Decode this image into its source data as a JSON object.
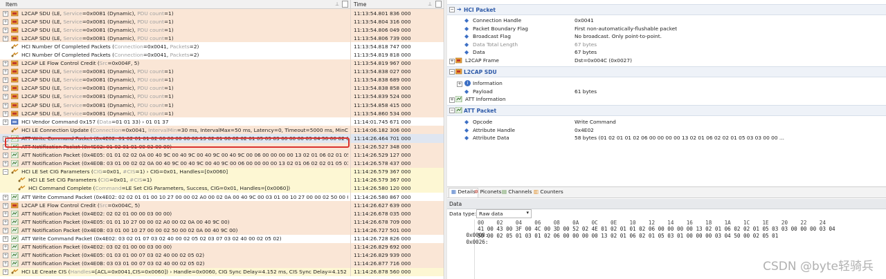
{
  "packet_list": {
    "col_item": "Item",
    "col_time": "Time",
    "rows": [
      {
        "bg": "salmon",
        "indent": 0,
        "exp": "+",
        "icon": "l2cap",
        "text": "L2CAP SDU (LE, ",
        "p1": "Service",
        "t1": "=0x0081 (Dynamic), ",
        "p2": "PDU count",
        "t2": "=1)",
        "time": "11:13:54.801 836 000"
      },
      {
        "bg": "salmon",
        "indent": 0,
        "exp": "+",
        "icon": "l2cap",
        "text": "L2CAP SDU (LE, ",
        "p1": "Service",
        "t1": "=0x0081 (Dynamic), ",
        "p2": "PDU count",
        "t2": "=1)",
        "time": "11:13:54.804 316 000"
      },
      {
        "bg": "salmon",
        "indent": 0,
        "exp": "+",
        "icon": "l2cap",
        "text": "L2CAP SDU (LE, ",
        "p1": "Service",
        "t1": "=0x0081 (Dynamic), ",
        "p2": "PDU count",
        "t2": "=1)",
        "time": "11:13:54.806 049 000"
      },
      {
        "bg": "salmon",
        "indent": 0,
        "exp": "+",
        "icon": "l2cap",
        "text": "L2CAP SDU (LE, ",
        "p1": "Service",
        "t1": "=0x0081 (Dynamic), ",
        "p2": "PDU count",
        "t2": "=1)",
        "time": "11:13:54.806 739 000"
      },
      {
        "bg": "white",
        "indent": 0,
        "exp": "",
        "icon": "hci",
        "text": "HCI Number Of Completed Packets (",
        "p1": "Connection",
        "t1": "=0x0041, ",
        "p2": "Packets",
        "t2": "=2)",
        "time": "11:13:54.818 747 000"
      },
      {
        "bg": "white",
        "indent": 0,
        "exp": "",
        "icon": "hci",
        "text": "HCI Number Of Completed Packets (",
        "p1": "Connection",
        "t1": "=0x0041, ",
        "p2": "Packets",
        "t2": "=2)",
        "time": "11:13:54.819 818 000"
      },
      {
        "bg": "salmon",
        "indent": 0,
        "exp": "+",
        "icon": "l2cap",
        "text": "L2CAP LE Flow Control Credit (",
        "p1": "Src",
        "t1": "=0x004F, 5)",
        "p2": "",
        "t2": "",
        "time": "11:13:54.819 967 000"
      },
      {
        "bg": "salmon",
        "indent": 0,
        "exp": "+",
        "icon": "l2cap",
        "text": "L2CAP SDU (LE, ",
        "p1": "Service",
        "t1": "=0x0081 (Dynamic), ",
        "p2": "PDU count",
        "t2": "=1)",
        "time": "11:13:54.838 027 000"
      },
      {
        "bg": "salmon",
        "indent": 0,
        "exp": "+",
        "icon": "l2cap",
        "text": "L2CAP SDU (LE, ",
        "p1": "Service",
        "t1": "=0x0081 (Dynamic), ",
        "p2": "PDU count",
        "t2": "=1)",
        "time": "11:13:54.838 689 000"
      },
      {
        "bg": "salmon",
        "indent": 0,
        "exp": "+",
        "icon": "l2cap",
        "text": "L2CAP SDU (LE, ",
        "p1": "Service",
        "t1": "=0x0081 (Dynamic), ",
        "p2": "PDU count",
        "t2": "=1)",
        "time": "11:13:54.838 858 000"
      },
      {
        "bg": "salmon",
        "indent": 0,
        "exp": "+",
        "icon": "l2cap",
        "text": "L2CAP SDU (LE, ",
        "p1": "Service",
        "t1": "=0x0081 (Dynamic), ",
        "p2": "PDU count",
        "t2": "=1)",
        "time": "11:13:54.839 524 000"
      },
      {
        "bg": "salmon",
        "indent": 0,
        "exp": "+",
        "icon": "l2cap",
        "text": "L2CAP SDU (LE, ",
        "p1": "Service",
        "t1": "=0x0081 (Dynamic), ",
        "p2": "PDU count",
        "t2": "=1)",
        "time": "11:13:54.858 415 000"
      },
      {
        "bg": "salmon",
        "indent": 0,
        "exp": "+",
        "icon": "l2cap",
        "text": "L2CAP SDU (LE, ",
        "p1": "Service",
        "t1": "=0x0081 (Dynamic), ",
        "p2": "PDU count",
        "t2": "=1)",
        "time": "11:13:54.860 534 000"
      },
      {
        "bg": "white",
        "indent": 0,
        "exp": "+",
        "icon": "vendor",
        "text": "HCI Vendor Command 0x157 (",
        "p1": "Data",
        "t1": "=01 01 33) › 01 01 37",
        "p2": "",
        "t2": "",
        "time": "11:14:01.745 671 000"
      },
      {
        "bg": "salmon",
        "indent": 0,
        "exp": "",
        "icon": "hci",
        "text": "HCI LE Connection Update (",
        "p1": "Connection",
        "t1": "=0x0041, ",
        "p2": "IntervalMin",
        "t2": "=30 ms, IntervalMax=50 ms, Latency=0, Timeout=5000 ms, MinCE=0 s, MaxCE=0 s) ›",
        "time": "11:14:06.182 306 000"
      },
      {
        "bg": "sel",
        "indent": 0,
        "exp": "+",
        "icon": "att",
        "text": "ATT Write Command Packet (0x4E02: 01 02 01 01 02 06 00 00 00 00 13 02 01 06 02 02 01 05 03 03 00 00 00 03 04 50 00 02 05 01 03 01 02 06 00",
        "p1": "",
        "t1": "",
        "p2": "",
        "t2": "",
        "time": "11:14:26.464 701 000"
      },
      {
        "bg": "salmon",
        "indent": 0,
        "exp": "+",
        "icon": "att",
        "text": "ATT Notification Packet (0x4E02: 01 02 01 01 00 03 00 00)",
        "p1": "",
        "t1": "",
        "p2": "",
        "t2": "",
        "time": "11:14:26.527 348 000"
      },
      {
        "bg": "salmon",
        "indent": 0,
        "exp": "+",
        "icon": "att",
        "text": "ATT Notification Packet (0x4E05: 01 01 02 02 0A 00 40 9C 00 40 9C 00 40 9C 00 40 9C 00 06 00 00 00 00 13 02 01 06 02 01 05 03 03 00 00",
        "p1": "",
        "t1": "",
        "p2": "",
        "t2": "",
        "time": "11:14:26.529 127 000"
      },
      {
        "bg": "salmon",
        "indent": 0,
        "exp": "+",
        "icon": "att",
        "text": "ATT Notification Packet (0x4E0B: 03 01 00 02 02 0A 00 40 9C 00 40 9C 00 40 9C 00 06 00 00 00 00 13 02 01 06 02 02 01 05 03 01 00 00 00",
        "p1": "",
        "t1": "",
        "p2": "",
        "t2": "",
        "time": "11:14:26.578 437 000"
      },
      {
        "bg": "yellow",
        "indent": 0,
        "exp": "-",
        "icon": "hci",
        "text": "HCI LE Set CIG Parameters (",
        "p1": "CIG",
        "t1": "=0x01, ",
        "p2": "#CIS",
        "t2": "=1) › CIG=0x01, Handles=[0x0060]",
        "time": "11:14:26.579 367 000"
      },
      {
        "bg": "yellow",
        "indent": 1,
        "exp": "",
        "icon": "hci",
        "text": "HCI LE Set CIG Parameters (",
        "p1": "CIG",
        "t1": "=0x01, ",
        "p2": "#CIS",
        "t2": "=1)",
        "time": "11:14:26.579 367 000"
      },
      {
        "bg": "yellow",
        "indent": 1,
        "exp": "",
        "icon": "hci",
        "text": "HCI Command Complete (",
        "p1": "Command",
        "t1": "=LE Set CIG Parameters, Success, CIG=0x01, Handles=[0x0060])",
        "p2": "",
        "t2": "",
        "time": "11:14:26.580 120 000"
      },
      {
        "bg": "white",
        "indent": 0,
        "exp": "+",
        "icon": "att",
        "text": "ATT Write Command Packet (0x4E02: 02 02 01 01 00 10 27 00 00 02 A0 00 02 0A 00 40 9C 00 03 01 00 10 27 00 00 02 50 00 02 0A 00 40 9C 00)",
        "p1": "",
        "t1": "",
        "p2": "",
        "t2": "",
        "time": "11:14:26.580 867 000"
      },
      {
        "bg": "salmon",
        "indent": 0,
        "exp": "+",
        "icon": "l2cap",
        "text": "L2CAP LE Flow Control Credit (",
        "p1": "Src",
        "t1": "=0x004C, 5)",
        "p2": "",
        "t2": "",
        "time": "11:14:26.627 639 000"
      },
      {
        "bg": "salmon",
        "indent": 0,
        "exp": "+",
        "icon": "att",
        "text": "ATT Notification Packet (0x4E02: 02 02 01 00 00 03 00 00)",
        "p1": "",
        "t1": "",
        "p2": "",
        "t2": "",
        "time": "11:14:26.678 035 000"
      },
      {
        "bg": "salmon",
        "indent": 0,
        "exp": "+",
        "icon": "att",
        "text": "ATT Notification Packet (0x4E05: 01 01 10 27 00 00 02 A0 00 02 0A 00 40 9C 00)",
        "p1": "",
        "t1": "",
        "p2": "",
        "t2": "",
        "time": "11:14:26.678 709 000"
      },
      {
        "bg": "salmon",
        "indent": 0,
        "exp": "+",
        "icon": "att",
        "text": "ATT Notification Packet (0x4E0B: 03 01 00 10 27 00 00 02 50 00 02 0A 00 40 9C 00)",
        "p1": "",
        "t1": "",
        "p2": "",
        "t2": "",
        "time": "11:14:26.727 501 000"
      },
      {
        "bg": "white",
        "indent": 0,
        "exp": "+",
        "icon": "att",
        "text": "ATT Write Command Packet (0x4E02: 03 02 01 07 03 02 40 00 02 05 02 03 07 03 02 40 00 02 05 02)",
        "p1": "",
        "t1": "",
        "p2": "",
        "t2": "",
        "time": "11:14:26.728 826 000"
      },
      {
        "bg": "salmon",
        "indent": 0,
        "exp": "+",
        "icon": "att",
        "text": "ATT Notification Packet (0x4E02: 03 02 01 00 00 03 00 00)",
        "p1": "",
        "t1": "",
        "p2": "",
        "t2": "",
        "time": "11:14:26.829 692 000"
      },
      {
        "bg": "salmon",
        "indent": 0,
        "exp": "+",
        "icon": "att",
        "text": "ATT Notification Packet (0x4E05: 01 03 01 00 07 03 02 40 00 02 05 02)",
        "p1": "",
        "t1": "",
        "p2": "",
        "t2": "",
        "time": "11:14:26.829 939 000"
      },
      {
        "bg": "salmon",
        "indent": 0,
        "exp": "+",
        "icon": "att",
        "text": "ATT Notification Packet (0x4E0B: 03 03 01 00 07 03 02 40 00 02 05 02)",
        "p1": "",
        "t1": "",
        "p2": "",
        "t2": "",
        "time": "11:14:26.877 716 000"
      },
      {
        "bg": "yellow",
        "indent": 0,
        "exp": "+",
        "icon": "hci",
        "text": "HCI LE Create CIS (",
        "p1": "Handles",
        "t1": "=[ACL=0x0041,CIS=0x0060]) › Handle=0x0060, CIG Sync Delay=4.152 ms, CIS Sync Delay=4.152 ms, Transport Latency",
        "p2": "",
        "t2": "",
        "time": "11:14:26.878 560 000"
      }
    ]
  },
  "detail": {
    "hci_title": "HCI Packet",
    "hci_fields": [
      {
        "label": "Connection Handle",
        "value": "0x0041",
        "grey": false
      },
      {
        "label": "Packet Boundary Flag",
        "value": "First non-automatically-flushable packet",
        "grey": false
      },
      {
        "label": "Broadcast Flag",
        "value": "No broadcast. Only point-to-point.",
        "grey": false
      },
      {
        "label": "Data Total Length",
        "value": "67 bytes",
        "grey": true
      },
      {
        "label": "Data",
        "value": "67 bytes",
        "grey": false
      }
    ],
    "l2cap_frame_label": "L2CAP Frame",
    "l2cap_frame_value": "Dst=0x004C (0x0027)",
    "l2cap_sdu_title": "L2CAP SDU",
    "information_label": "Information",
    "payload_label": "Payload",
    "payload_value": "61 bytes",
    "att_information_label": "ATT Information",
    "att_title": "ATT Packet",
    "att_fields": [
      {
        "label": "Opcode",
        "value": "Write Command"
      },
      {
        "label": "Attribute Handle",
        "value": "0x4E02"
      },
      {
        "label": "Attribute Data",
        "value": "58 bytes (01 02 01 01 02 06 00 00 00 00 13 02 01 06 02 02 01 05 03 03 00 00 ..."
      }
    ]
  },
  "tabs": [
    {
      "label": "Details",
      "icon": "details-icon",
      "active": true
    },
    {
      "label": "Piconets",
      "icon": "piconets-icon",
      "active": false
    },
    {
      "label": "Channels",
      "icon": "channels-icon",
      "active": false
    },
    {
      "label": "Counters",
      "icon": "counters-icon",
      "active": false
    }
  ],
  "data_panel": {
    "title": "Data",
    "data_type_label": "Data type:",
    "data_type_value": "Raw data",
    "columns": "00    02    04    06    08    0A    0C    0E    10    12    14    16    18    1A    1C    1E    20    22    24",
    "lines": [
      {
        "offset": "0x0000:",
        "hex": "41 00 43 00 3F 00 4C 00 3D 00 52 02 4E 01 02 01 01 02 06 00 00 00 00 13 02 01 06 02 02 01 05 03 03 00 00 00 03 04"
      },
      {
        "offset": "0x0026:",
        "hex": "50 00 02 05 01 03 01 02 06 00 00 00 00 13 02 01 06 02 01 05 03 01 00 00 00 03 04 50 00 02 05 01"
      }
    ]
  },
  "watermark": "CSDN @byte轻骑兵"
}
